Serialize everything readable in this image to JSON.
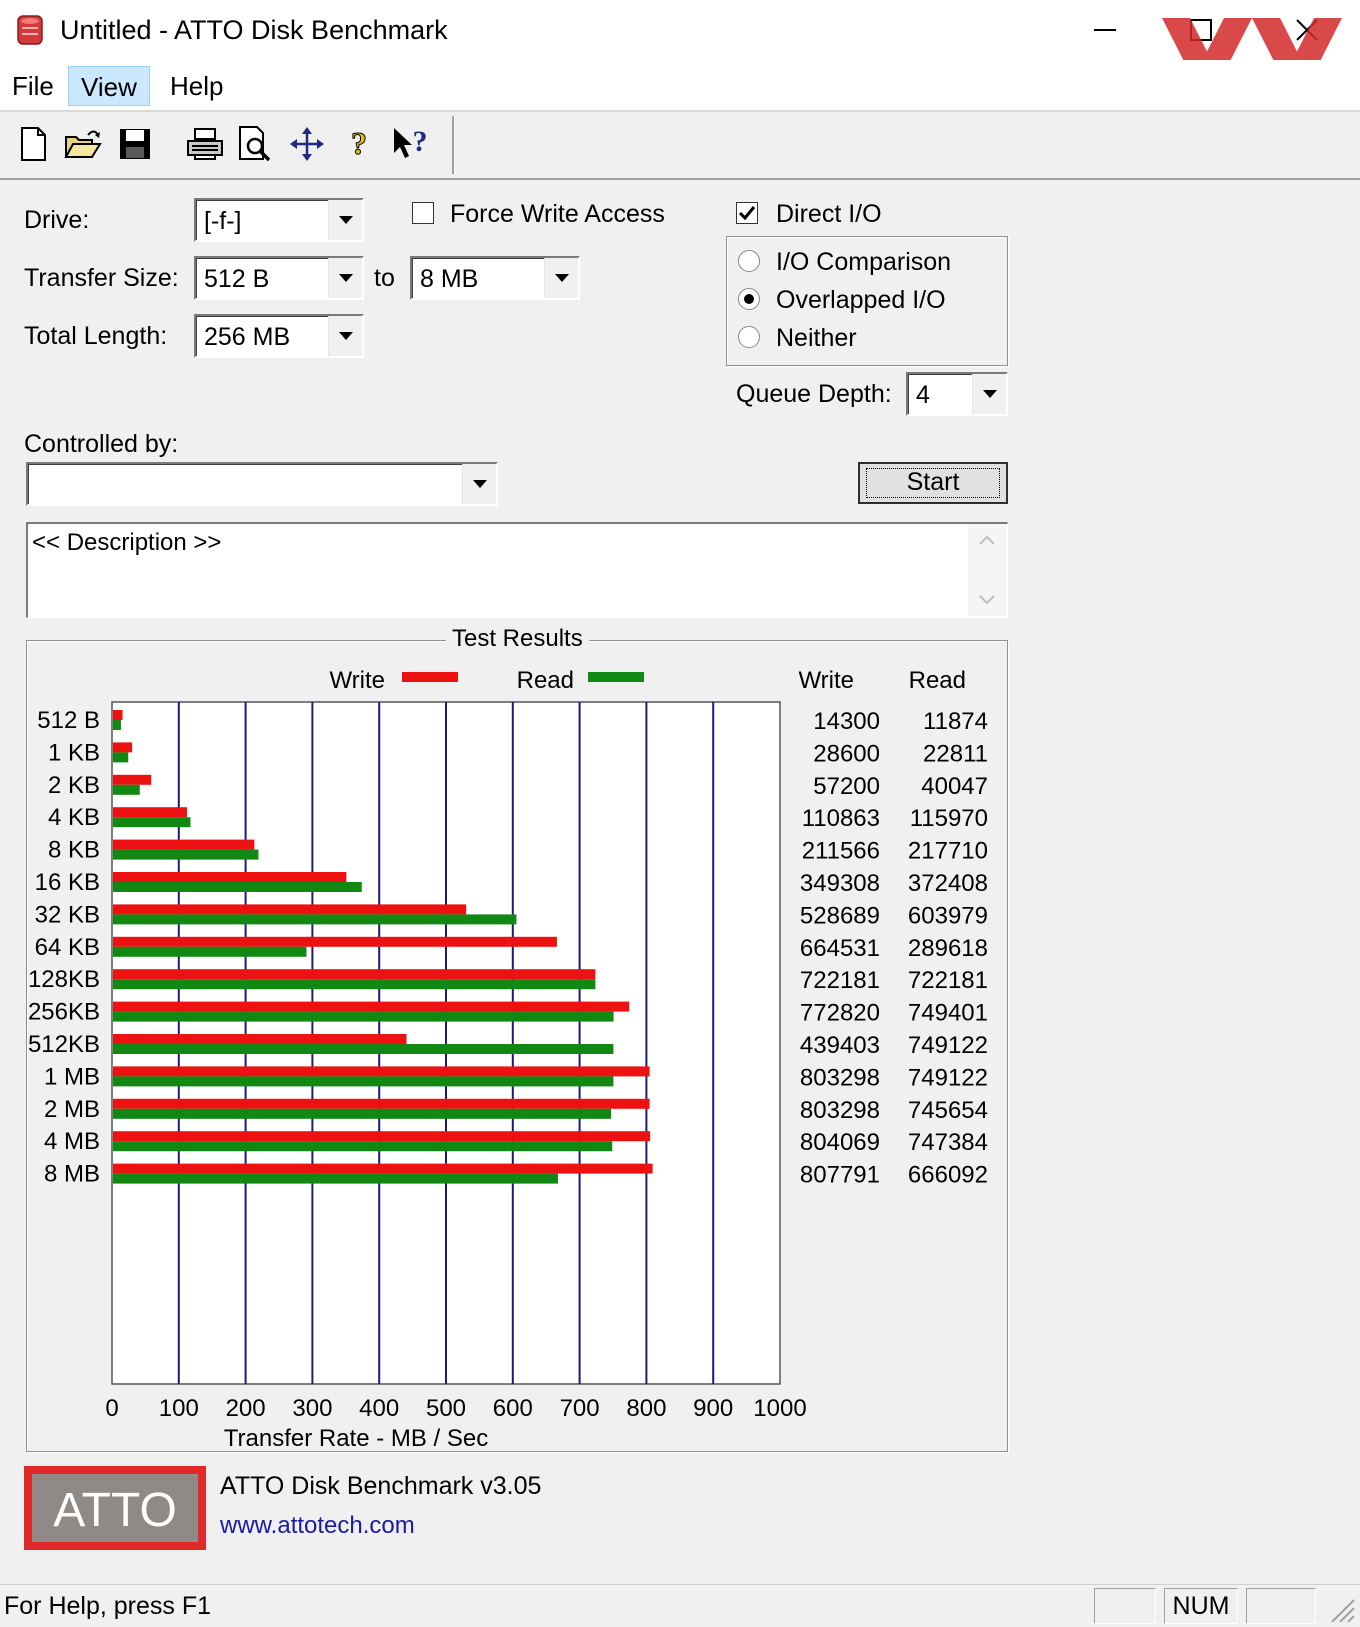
{
  "window": {
    "title": "Untitled - ATTO Disk Benchmark",
    "icon": "atto-app-icon"
  },
  "menu": {
    "file": "File",
    "view": "View",
    "help": "Help"
  },
  "toolbar": {
    "icons": [
      "new-file-icon",
      "open-folder-icon",
      "save-icon",
      "print-icon",
      "print-preview-icon",
      "move-icon",
      "help-icon",
      "context-help-icon"
    ]
  },
  "form": {
    "drive_label": "Drive:",
    "drive_value": "[-f-]",
    "force_write_label": "Force Write Access",
    "force_write_checked": false,
    "direct_io_label": "Direct I/O",
    "direct_io_checked": true,
    "transfer_size_label": "Transfer Size:",
    "transfer_from": "512 B",
    "to_label": "to",
    "transfer_to": "8 MB",
    "total_length_label": "Total Length:",
    "total_length_value": "256 MB",
    "io_options": [
      {
        "label": "I/O Comparison",
        "selected": false
      },
      {
        "label": "Overlapped I/O",
        "selected": true
      },
      {
        "label": "Neither",
        "selected": false
      }
    ],
    "queue_depth_label": "Queue Depth:",
    "queue_depth_value": "4",
    "controlled_by_label": "Controlled by:",
    "controlled_by_value": "",
    "start_label": "Start",
    "description": "<< Description >>"
  },
  "results": {
    "group_title": "Test Results",
    "legend_write": "Write",
    "legend_read": "Read",
    "col_write": "Write",
    "col_read": "Read",
    "write_color": "#ee1111",
    "read_color": "#118811",
    "grid_color": "#1a1a80"
  },
  "chart_data": {
    "type": "bar",
    "orientation": "horizontal",
    "categories": [
      "512 B",
      "1 KB",
      "2 KB",
      "4 KB",
      "8 KB",
      "16 KB",
      "32 KB",
      "64 KB",
      "128KB",
      "256KB",
      "512KB",
      "1 MB",
      "2 MB",
      "4 MB",
      "8 MB"
    ],
    "series": [
      {
        "name": "Write",
        "values": [
          14300,
          28600,
          57200,
          110863,
          211566,
          349308,
          528689,
          664531,
          722181,
          772820,
          439403,
          803298,
          803298,
          804069,
          807791
        ]
      },
      {
        "name": "Read",
        "values": [
          11874,
          22811,
          40047,
          115970,
          217710,
          372408,
          603979,
          289618,
          722181,
          749401,
          749122,
          749122,
          745654,
          747384,
          666092
        ]
      }
    ],
    "xlabel": "Transfer Rate - MB / Sec",
    "xticks": [
      "0",
      "100",
      "200",
      "300",
      "400",
      "500",
      "600",
      "700",
      "800",
      "900",
      "1000"
    ],
    "xlim": [
      0,
      1000
    ],
    "value_unit_divisor": 1000,
    "grid": true,
    "legend_position": "top"
  },
  "footer": {
    "logo_text": "ATTO",
    "version": "ATTO Disk Benchmark v3.05",
    "website": "www.attotech.com"
  },
  "statusbar": {
    "help_text": "For Help, press F1",
    "num_indicator": "NUM"
  }
}
